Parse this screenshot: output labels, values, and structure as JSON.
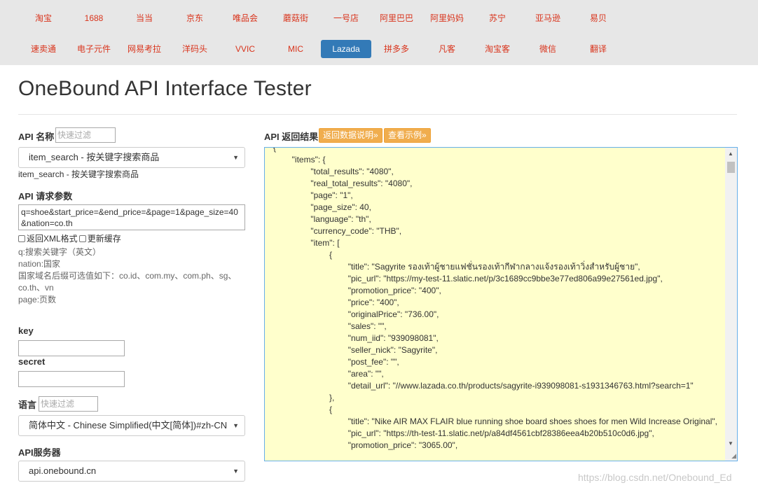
{
  "nav": {
    "row1": [
      "淘宝",
      "1688",
      "当当",
      "京东",
      "唯品会",
      "蘑菇街",
      "一号店",
      "阿里巴巴",
      "阿里妈妈",
      "苏宁",
      "亚马逊",
      "易贝"
    ],
    "row2": [
      "速卖通",
      "电子元件",
      "网易考拉",
      "洋码头",
      "VVIC",
      "MIC",
      "Lazada",
      "拼多多",
      "凡客",
      "淘宝客",
      "微信",
      "翻译"
    ],
    "active": "Lazada"
  },
  "page": {
    "title": "OneBound API Interface Tester"
  },
  "left": {
    "api_name_label": "API 名称",
    "api_filter_placeholder": "快速过滤",
    "api_select_value": "item_search - 按关键字搜索商品",
    "api_select_caption": "item_search - 按关键字搜索商品",
    "params_label": "API 请求参数",
    "params_value": "q=shoe&start_price=&end_price=&page=1&page_size=40&nation=co.th",
    "xml_label": "返回XML格式",
    "cache_label": "更新缓存",
    "hints": [
      "q:搜索关键字（英文）",
      "nation:国家",
      "国家域名后缀可选值如下：co.id、com.my、com.ph、sg、co.th、vn",
      "page:页数"
    ],
    "key_label": "key",
    "secret_label": "secret",
    "lang_label": "语言",
    "lang_filter_placeholder": "快速过滤",
    "lang_select_value": "简体中文 - Chinese Simplified(中文[简体])#zh-CN",
    "server_label": "API服务器",
    "server_select_value": "api.onebound.cn"
  },
  "right": {
    "result_label": "API 返回结果",
    "btn_doc": "返回数据说明»",
    "btn_example": "查看示例»",
    "code_lines": [
      "{",
      "        \"items\": {",
      "                \"total_results\": \"4080\",",
      "                \"real_total_results\": \"4080\",",
      "                \"page\": \"1\",",
      "                \"page_size\": 40,",
      "                \"language\": \"th\",",
      "                \"currency_code\": \"THB\",",
      "                \"item\": [",
      "                        {",
      "                                \"title\": \"Sagyrite รองเท้าผู้ชายแฟชั่นรองเท้ากีฬากลางแจ้งรองเท้าวิ่งสำหรับผู้ชาย\",",
      "                                \"pic_url\": \"https://my-test-11.slatic.net/p/3c1689cc9bbe3e77ed806a99e27561ed.jpg\",",
      "                                \"promotion_price\": \"400\",",
      "                                \"price\": \"400\",",
      "                                \"originalPrice\": \"736.00\",",
      "                                \"sales\": \"\",",
      "                                \"num_iid\": \"939098081\",",
      "                                \"seller_nick\": \"Sagyrite\",",
      "                                \"post_fee\": \"\",",
      "                                \"area\": \"\",",
      "                                \"detail_url\": \"//www.lazada.co.th/products/sagyrite-i939098081-s1931346763.html?search=1\"",
      "                        },",
      "                        {",
      "                                \"title\": \"Nike AIR MAX FLAIR blue running shoe board shoes shoes for men Wild Increase Original\",",
      "                                \"pic_url\": \"https://th-test-11.slatic.net/p/a84df4561cbf28386eea4b20b510c0d6.jpg\",",
      "                                \"promotion_price\": \"3065.00\","
    ]
  },
  "watermark": "https://blog.csdn.net/Onebound_Ed"
}
